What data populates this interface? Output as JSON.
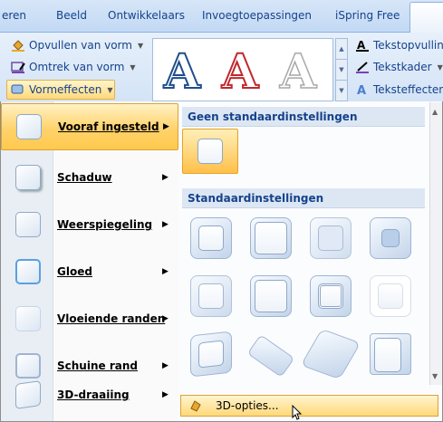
{
  "tabs": [
    "eren",
    "Beeld",
    "Ontwikkelaars",
    "Invoegtoepassingen",
    "iSpring Free"
  ],
  "ribbon": {
    "shape_fill": "Opvullen van vorm",
    "shape_outline": "Omtrek van vorm",
    "shape_effects": "Vormeffecten",
    "text_fill": "Tekstopvulling",
    "text_outline": "Tekstkader",
    "text_effects": "Teksteffecten",
    "wordart_glyph": "A"
  },
  "menu": {
    "items": [
      {
        "label": "Vooraf ingesteld",
        "active": true
      },
      {
        "label": "Schaduw"
      },
      {
        "label": "Weerspiegeling"
      },
      {
        "label": "Gloed"
      },
      {
        "label": "Vloeiende randen"
      },
      {
        "label": "Schuine rand"
      },
      {
        "label": "3D-draaiing"
      }
    ]
  },
  "panel": {
    "section_none": "Geen standaardinstellingen",
    "section_presets": "Standaardinstellingen",
    "footer": "3D-opties..."
  },
  "colors": {
    "accent": "#ffd26b",
    "text_blue": "#15428b"
  }
}
